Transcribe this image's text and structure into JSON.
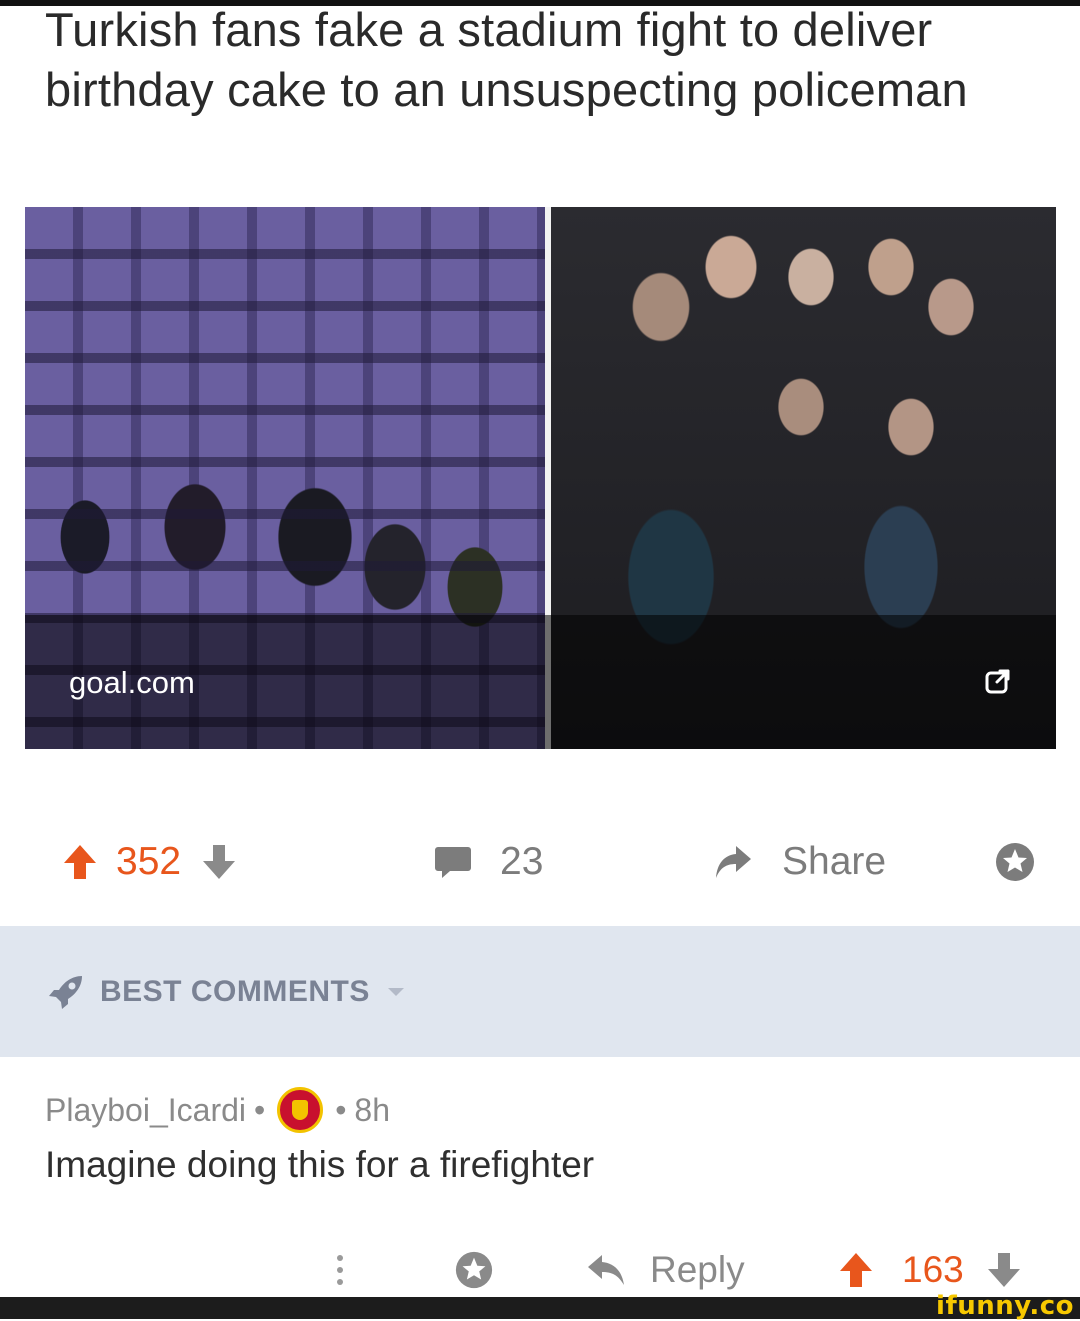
{
  "post": {
    "title": "Turkish fans fake a stadium fight to deliver birthday cake to an unsuspecting policeman",
    "link_source": "goal.com",
    "score": "352",
    "comment_count": "23",
    "share_label": "Share"
  },
  "comments_section": {
    "header": "BEST COMMENTS"
  },
  "comment": {
    "username": "Playboi_Icardi",
    "separator": "•",
    "age": "8h",
    "text": "Imagine doing this for a firefighter",
    "reply_label": "Reply",
    "score": "163"
  },
  "watermark": "ifunny.co",
  "colors": {
    "upvote": "#e8561c",
    "muted": "#7c7c7c",
    "best_bar": "#e0e6ef"
  }
}
